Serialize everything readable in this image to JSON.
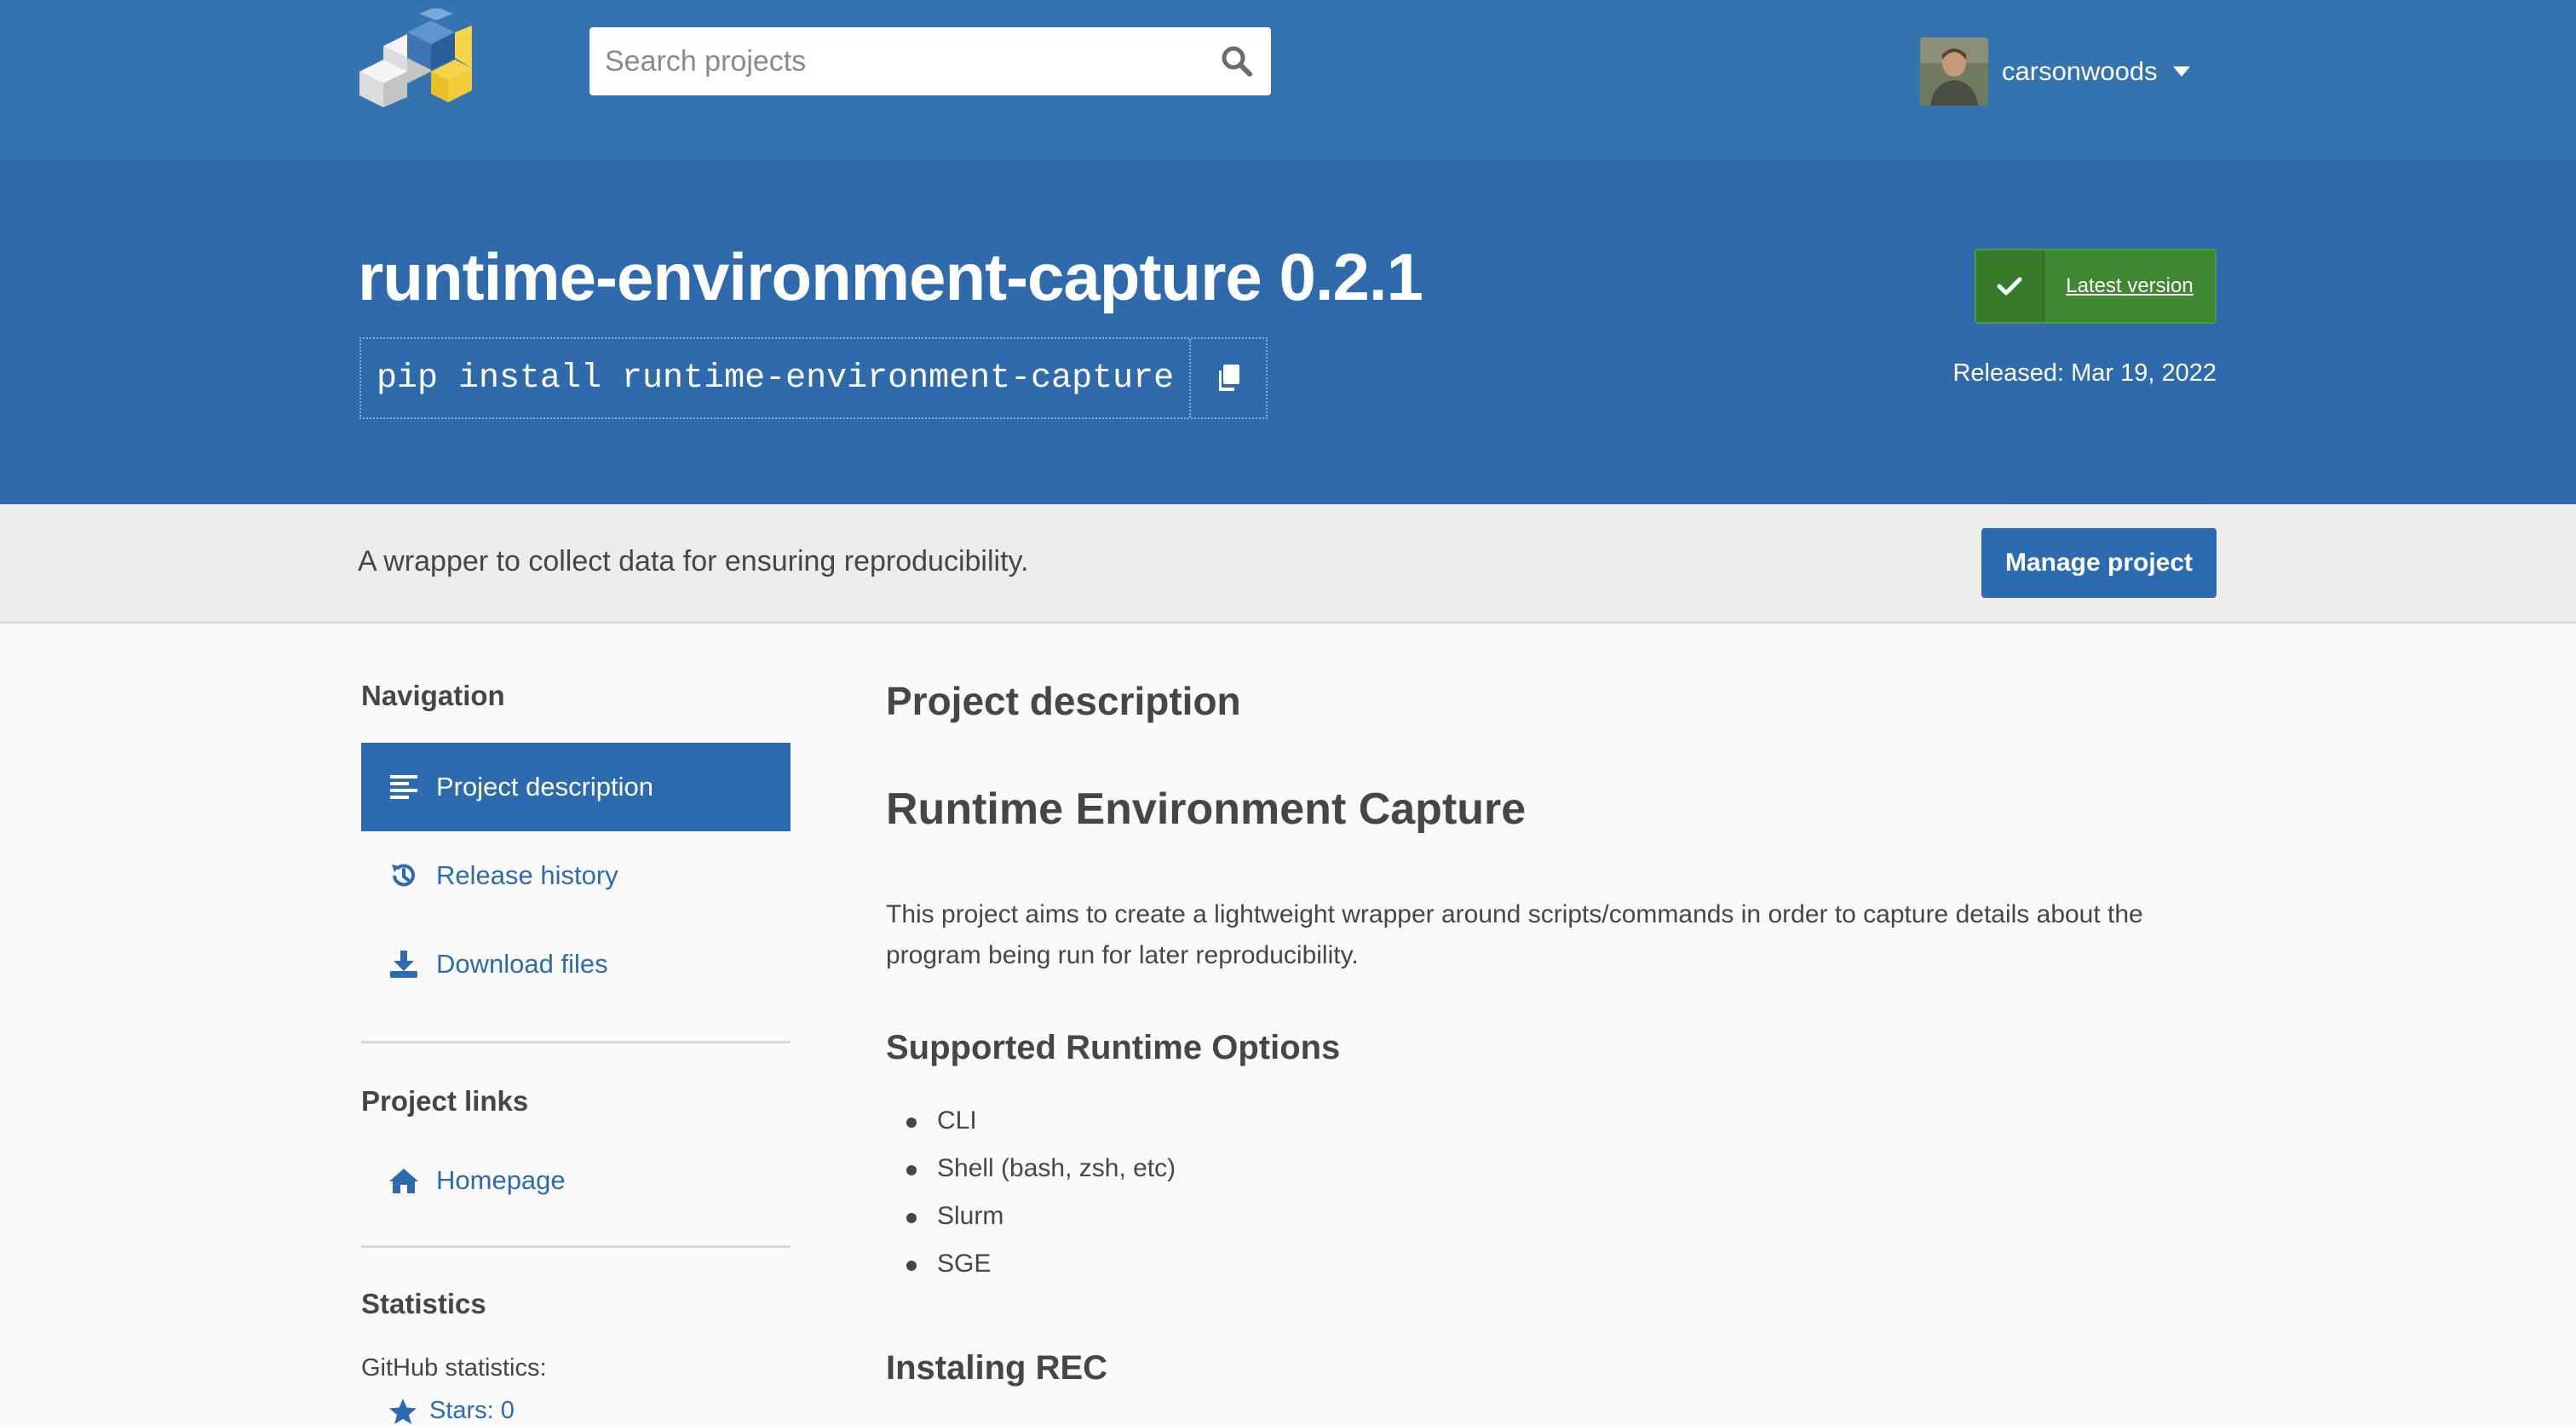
{
  "header": {
    "search_placeholder": "Search projects",
    "username": "carsonwoods"
  },
  "banner": {
    "package_title": "runtime-environment-capture 0.2.1",
    "pip_command": "pip install runtime-environment-capture",
    "latest_version_label": "Latest version",
    "released": "Released: Mar 19, 2022"
  },
  "summary": {
    "text": "A wrapper to collect data for ensuring reproducibility.",
    "manage_label": "Manage project"
  },
  "sidebar": {
    "nav_heading": "Navigation",
    "nav_items": [
      {
        "label": "Project description",
        "icon": "align-left-icon",
        "active": true
      },
      {
        "label": "Release history",
        "icon": "history-icon",
        "active": false
      },
      {
        "label": "Download files",
        "icon": "download-icon",
        "active": false
      }
    ],
    "links_heading": "Project links",
    "homepage_label": "Homepage",
    "stats_heading": "Statistics",
    "github_stats_label": "GitHub statistics:",
    "stars_label": "Stars: 0"
  },
  "main": {
    "description_heading": "Project description",
    "readme_title": "Runtime Environment Capture",
    "intro_paragraph": "This project aims to create a lightweight wrapper around scripts/commands in order to capture details about the program being run for later reproducibility.",
    "options_heading": "Supported Runtime Options",
    "options": [
      "CLI",
      "Shell (bash, zsh, etc)",
      "Slurm",
      "SGE"
    ],
    "install_heading": "Instaling REC"
  },
  "colors": {
    "header_blue": "#3572b0",
    "banner_blue": "#2f6aac",
    "link_blue": "#2d6bb0",
    "latest_green": "#3f8730",
    "summary_gray": "#ececec"
  }
}
